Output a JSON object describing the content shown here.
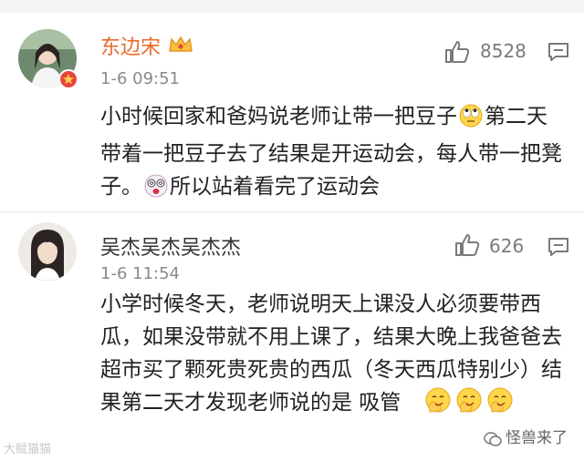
{
  "comments": [
    {
      "username": "东边宋",
      "time": "1-6 09:51",
      "likes": "8528",
      "text_a": "小时候回家和爸妈说老师让带一把豆子",
      "text_b": "第二天带着一把豆子去了结果是开运动会，每人带一把凳子。",
      "text_c": "所以站着看完了运动会",
      "icons": [
        "avatar",
        "verified-badge-icon",
        "crown-icon",
        "thumbs-up-icon",
        "reply-icon",
        "rolling-eyes-emoji",
        "dizzy-emoji"
      ]
    },
    {
      "username": "吴杰吴杰吴杰杰",
      "time": "1-6 11:54",
      "likes": "626",
      "text_a": "小学时候冬天，老师说明天上课没人必须要带西瓜，如果没带就不用上课了，结果大晚上我爸爸去超市买了颗死贵死贵的西瓜（冬天西瓜特别少）结果第二天才发现老师说的是 吸管",
      "icons": [
        "avatar",
        "thumbs-up-icon",
        "reply-icon",
        "facepalm-emoji"
      ]
    }
  ],
  "watermark_left": "大赋猫猫",
  "watermark_right": "怪兽来了",
  "colors": {
    "vip_name": "#e86b2a",
    "badge": "#e8453c",
    "time": "#8a8a8a"
  }
}
